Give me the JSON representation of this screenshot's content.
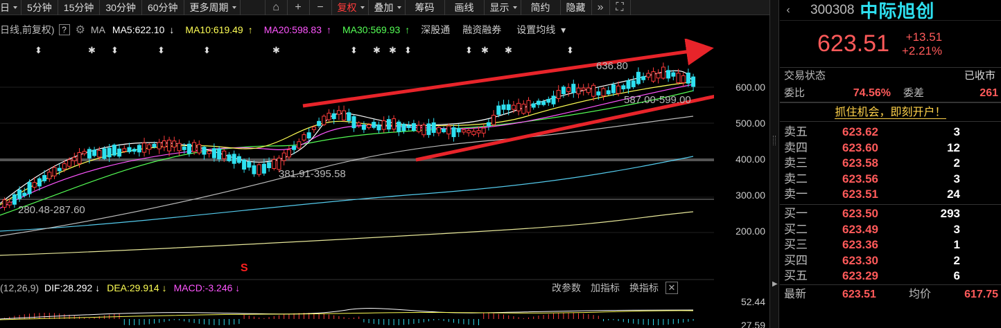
{
  "toolbar": {
    "period_day": "日",
    "items": [
      "5分钟",
      "15分钟",
      "30分钟",
      "60分钟",
      "更多周期"
    ],
    "right": [
      "复权",
      "叠加",
      "筹码",
      "画线",
      "显示",
      "简约",
      "隐藏"
    ]
  },
  "info": {
    "title": "日线,前复权)",
    "help": "?",
    "ma_label": "MA",
    "ma5": "MA5:622.10",
    "ma10": "MA10:619.49",
    "ma20": "MA20:598.83",
    "ma30": "MA30:569.93",
    "ma5_arrow": "↓",
    "ma10_arrow": "↑",
    "ma20_arrow": "↑",
    "ma30_arrow": "↑",
    "sgt": "深股通",
    "rzrq": "融资融券",
    "setting": "设置均线"
  },
  "annotations": {
    "high": "636.80",
    "range1": "587.00-599.00",
    "range2": "381.91-395.58",
    "range3": "280.48-287.60",
    "s_marker": "S"
  },
  "axis": [
    "600.00",
    "500.00",
    "400.00",
    "300.00",
    "200.00",
    "52.44",
    "27.59"
  ],
  "macd": {
    "params": "(12,26,9)",
    "dif": "DIF:28.292",
    "dif_arrow": "↓",
    "dea": "DEA:29.914",
    "dea_arrow": "↓",
    "macd": "MACD:-3.246",
    "macd_arrow": "↓",
    "btn_params": "改参数",
    "btn_add": "加指标",
    "btn_switch": "换指标",
    "close": "✕"
  },
  "quote": {
    "code": "300308",
    "name": "中际旭创",
    "price": "623.51",
    "change": "+13.51",
    "change_pct": "+2.21%",
    "state_label": "交易状态",
    "state_value": "已收市",
    "wb_label": "委比",
    "wb_value": "74.56%",
    "wc_label": "委差",
    "wc_value": "261",
    "open_account": "抓住机会，即刻开户！",
    "asks": [
      {
        "label": "卖五",
        "price": "623.62",
        "vol": "3"
      },
      {
        "label": "卖四",
        "price": "623.60",
        "vol": "12"
      },
      {
        "label": "卖三",
        "price": "623.58",
        "vol": "2"
      },
      {
        "label": "卖二",
        "price": "623.56",
        "vol": "3"
      },
      {
        "label": "卖一",
        "price": "623.51",
        "vol": "24"
      }
    ],
    "bids": [
      {
        "label": "买一",
        "price": "623.50",
        "vol": "293"
      },
      {
        "label": "买二",
        "price": "623.49",
        "vol": "3"
      },
      {
        "label": "买三",
        "price": "623.36",
        "vol": "1"
      },
      {
        "label": "买四",
        "price": "623.30",
        "vol": "2"
      },
      {
        "label": "买五",
        "price": "623.29",
        "vol": "6"
      }
    ],
    "last_label": "最新",
    "last_value": "623.51",
    "avg_label": "均价",
    "avg_value": "617.75"
  },
  "colors": {
    "up": "#ff3b3b",
    "down": "#2ee0f0",
    "ma5": "#ffffff",
    "ma10": "#ffff55",
    "ma20": "#ff55ff",
    "ma30": "#55ff55",
    "arrow": "#e8242a"
  }
}
